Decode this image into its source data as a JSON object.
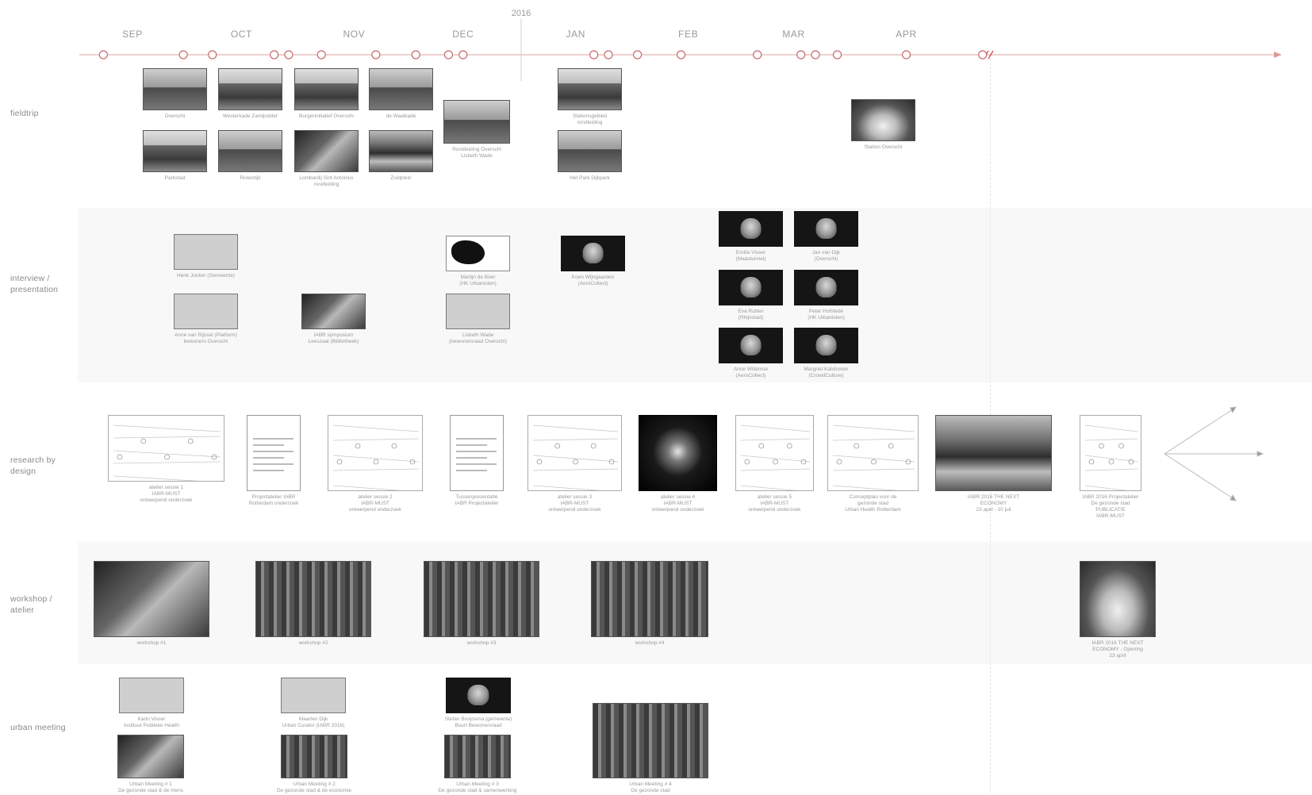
{
  "year_label": "2016",
  "months": [
    {
      "label": "SEP",
      "day": 0
    },
    {
      "label": "OCT",
      "day": 30
    },
    {
      "label": "NOV",
      "day": 61
    },
    {
      "label": "DEC",
      "day": 91
    },
    {
      "label": "JAN",
      "day": 122
    },
    {
      "label": "FEB",
      "day": 153
    },
    {
      "label": "MAR",
      "day": 182
    },
    {
      "label": "APR",
      "day": 213
    }
  ],
  "event_days": [
    -8,
    14,
    22,
    39,
    43,
    52,
    67,
    78,
    87,
    91,
    127,
    131,
    139,
    151,
    172,
    184,
    188,
    194,
    213,
    234
  ],
  "rows": [
    {
      "id": "fieldtrip",
      "label": "fieldtrip"
    },
    {
      "id": "interview",
      "label": "interview /\npresentation"
    },
    {
      "id": "research",
      "label": "research by\ndesign"
    },
    {
      "id": "workshop",
      "label": "workshop /\natelier"
    },
    {
      "id": "urban",
      "label": "urban meeting"
    }
  ],
  "items": [
    {
      "row": "fieldtrip",
      "style": "photo-street",
      "caption": "Overschi"
    },
    {
      "row": "fieldtrip",
      "style": "photo-build",
      "caption": "Westerkade Zandpolder"
    },
    {
      "row": "fieldtrip",
      "style": "photo-build",
      "caption": "Burgerinitiatief Overschi"
    },
    {
      "row": "fieldtrip",
      "style": "photo-street",
      "caption": "de Waalkade"
    },
    {
      "row": "fieldtrip",
      "style": "photo-build",
      "caption": "Parkstad"
    },
    {
      "row": "fieldtrip",
      "style": "photo-street",
      "caption": "Rivierdijk"
    },
    {
      "row": "fieldtrip",
      "style": "photo-room",
      "caption": "Lombardij Sint Antonius\nrondleiding"
    },
    {
      "row": "fieldtrip",
      "style": "photo-aerial",
      "caption": "Zuidplein"
    },
    {
      "row": "fieldtrip",
      "style": "photo-street",
      "caption": "Rondleiding Overschi\nLisbeth Wade"
    },
    {
      "row": "fieldtrip",
      "style": "photo-build",
      "caption": "Stationsgebied\nrondleiding"
    },
    {
      "row": "fieldtrip",
      "style": "photo-street",
      "caption": "Het Park Dijkpark"
    },
    {
      "row": "fieldtrip",
      "style": "photo-arch",
      "caption": "Station Overschi"
    },
    {
      "row": "interview",
      "style": "portrait-light",
      "caption": "Henk Jonker (Gemeente)"
    },
    {
      "row": "interview",
      "style": "portrait-light",
      "caption": "Anne van Rijssel (Platform)\nbewoners Overschi"
    },
    {
      "row": "interview",
      "style": "photo-room",
      "caption": "IABR symposium\nLeeszaal (Bibliotheek)"
    },
    {
      "row": "interview",
      "style": "logo-hk",
      "caption": "Martijn de Boer\n(HK Urbanisten)"
    },
    {
      "row": "interview",
      "style": "portrait-light",
      "caption": "Lisbeth Wade\n(bewonersraad Overschi)"
    },
    {
      "row": "interview",
      "style": "portrait",
      "caption": "Koen Wijngaarden\n(AeroCollect)"
    },
    {
      "row": "interview",
      "style": "portrait",
      "caption": "Emilie Visser\n(Maastunnel)"
    },
    {
      "row": "interview",
      "style": "portrait",
      "caption": "Jan van Dijk\n(Overschi)"
    },
    {
      "row": "interview",
      "style": "portrait",
      "caption": "Eva Rutten\n(Rhijnstad)"
    },
    {
      "row": "interview",
      "style": "portrait",
      "caption": "Peter Hofstede\n(HK Urbanisten)"
    },
    {
      "row": "interview",
      "style": "portrait",
      "caption": "Anne Willemse\n(AeroCollect)"
    },
    {
      "row": "interview",
      "style": "portrait",
      "caption": "Margriet Kalshoven\n(CrowdCulture)"
    },
    {
      "row": "research",
      "style": "drw",
      "caption": "atelier sessie 1\nIABR-MUST\nontwerpend onderzoek"
    },
    {
      "row": "research",
      "style": "doc",
      "caption": "Projectatelier IABR\nRotterdam onderzoek"
    },
    {
      "row": "research",
      "style": "drw",
      "caption": "atelier sessie 2\nIABR-MUST\nontwerpend onderzoek"
    },
    {
      "row": "research",
      "style": "doc",
      "caption": "Tussenpresentatie\nIABR Projectatelier"
    },
    {
      "row": "research",
      "style": "drw",
      "caption": "atelier sessie 3\nIABR-MUST\nontwerpend onderzoek"
    },
    {
      "row": "research",
      "style": "dark-map",
      "caption": "atelier sessie 4\nIABR-MUST\nontwerpend onderzoek"
    },
    {
      "row": "research",
      "style": "drw",
      "caption": "atelier sessie 5\nIABR-MUST\nontwerpend onderzoek"
    },
    {
      "row": "research",
      "style": "drw",
      "caption": "Conceptplan voor de\ngezonde stad\nUrban Health Rotterdam"
    },
    {
      "row": "research",
      "style": "photo-aerial",
      "caption": "IABR 2016 THE NEXT\nECONOMY\n23 april - 10 juli"
    },
    {
      "row": "research",
      "style": "drw",
      "caption": "IABR 2016 Projectatelier\nDe gezonde stad\nPUBLICATIE\nIABR-MUST"
    },
    {
      "row": "workshop",
      "style": "photo-room",
      "caption": "workshop #1"
    },
    {
      "row": "workshop",
      "style": "photo-crowd",
      "caption": "workshop #2"
    },
    {
      "row": "workshop",
      "style": "photo-crowd",
      "caption": "workshop #3"
    },
    {
      "row": "workshop",
      "style": "photo-crowd",
      "caption": "workshop #4"
    },
    {
      "row": "workshop",
      "style": "photo-arch",
      "caption": "IABR 2016 THE NEXT\nECONOMY - Opening\n23 april"
    },
    {
      "row": "urban",
      "style": "portrait-light",
      "caption": "Karin Visser\nInstituut Publieke Health"
    },
    {
      "row": "urban",
      "style": "portrait-light",
      "caption": "Maarten Dijk\nUrban Curator (IABR 2016)"
    },
    {
      "row": "urban",
      "style": "portrait",
      "caption": "Stefan Bruijnsma (gemeente)\nBuurt Bewonersraad"
    },
    {
      "row": "urban",
      "style": "photo-room",
      "caption": "Urban Meeting # 1\nDe gezonde stad & de mens"
    },
    {
      "row": "urban",
      "style": "photo-crowd",
      "caption": "Urban Meeting # 2\nDe gezonde stad & de economie"
    },
    {
      "row": "urban",
      "style": "photo-crowd",
      "caption": "Urban Meeting # 3\nDe gezonde stad & samenwerking"
    },
    {
      "row": "urban",
      "style": "photo-crowd",
      "caption": "Urban Meeting # 4\nDe gezonde stad"
    }
  ],
  "colors": {
    "timeline": "#e3b5b5",
    "dot": "#c96a6a",
    "break": "#d24a4a",
    "text": "#8a8a8a",
    "band": "#f8f8f8"
  }
}
